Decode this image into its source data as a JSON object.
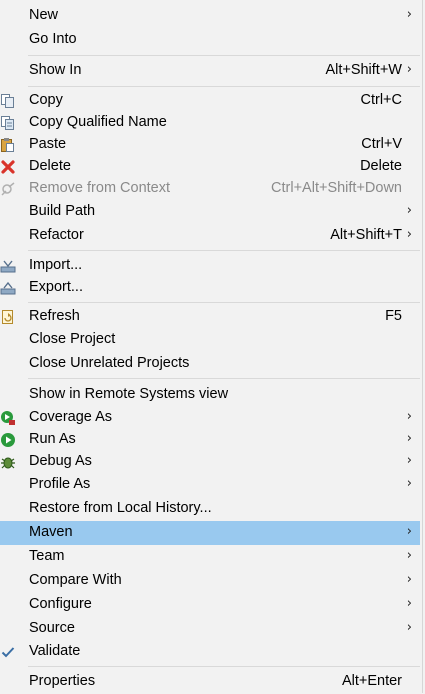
{
  "menu": {
    "new": {
      "label": "New"
    },
    "go_into": {
      "label": "Go Into"
    },
    "show_in": {
      "label": "Show In",
      "shortcut": "Alt+Shift+W"
    },
    "copy": {
      "label": "Copy",
      "shortcut": "Ctrl+C"
    },
    "copy_qualified_name": {
      "label": "Copy Qualified Name"
    },
    "paste": {
      "label": "Paste",
      "shortcut": "Ctrl+V"
    },
    "delete": {
      "label": "Delete",
      "shortcut": "Delete"
    },
    "remove_from_context": {
      "label": "Remove from Context",
      "shortcut": "Ctrl+Alt+Shift+Down"
    },
    "build_path": {
      "label": "Build Path"
    },
    "refactor": {
      "label": "Refactor",
      "shortcut": "Alt+Shift+T"
    },
    "import": {
      "label": "Import..."
    },
    "export": {
      "label": "Export..."
    },
    "refresh": {
      "label": "Refresh",
      "shortcut": "F5"
    },
    "close_project": {
      "label": "Close Project"
    },
    "close_unrelated_projects": {
      "label": "Close Unrelated Projects"
    },
    "show_in_remote_systems": {
      "label": "Show in Remote Systems view"
    },
    "coverage_as": {
      "label": "Coverage As"
    },
    "run_as": {
      "label": "Run As"
    },
    "debug_as": {
      "label": "Debug As"
    },
    "profile_as": {
      "label": "Profile As"
    },
    "restore_from_local_history": {
      "label": "Restore from Local History..."
    },
    "maven": {
      "label": "Maven"
    },
    "team": {
      "label": "Team"
    },
    "compare_with": {
      "label": "Compare With"
    },
    "configure": {
      "label": "Configure"
    },
    "source": {
      "label": "Source"
    },
    "validate": {
      "label": "Validate"
    },
    "properties": {
      "label": "Properties",
      "shortcut": "Alt+Enter"
    }
  },
  "submenu_arrow": "›",
  "colors": {
    "background": "#f2f2f2",
    "highlight": "#99c9ef",
    "disabled_text": "#8a8a8a",
    "delete_icon": "#d9342b",
    "run_icon": "#2a9a3c"
  }
}
